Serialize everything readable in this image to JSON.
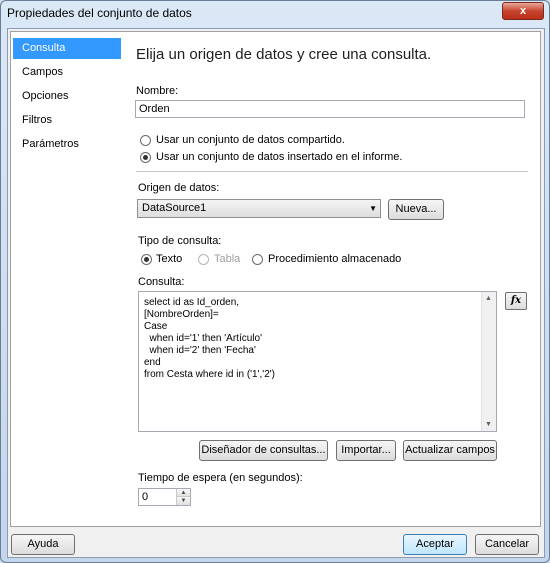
{
  "window": {
    "title": "Propiedades del conjunto de datos",
    "close_label": "x"
  },
  "sidebar": {
    "items": [
      {
        "label": "Consulta"
      },
      {
        "label": "Campos"
      },
      {
        "label": "Opciones"
      },
      {
        "label": "Filtros"
      },
      {
        "label": "Parámetros"
      }
    ],
    "selected": "Consulta"
  },
  "main": {
    "heading": "Elija un origen de datos y cree una consulta.",
    "name_label": "Nombre:",
    "name_value": "Orden",
    "radio_shared": "Usar un conjunto de datos compartido.",
    "radio_embedded": "Usar un conjunto de datos insertado en el informe.",
    "datasource_label": "Origen de datos:",
    "datasource_value": "DataSource1",
    "new_button": "Nueva...",
    "query_type_label": "Tipo de consulta:",
    "query_type_text": "Texto",
    "query_type_table": "Tabla",
    "query_type_sp": "Procedimiento almacenado",
    "query_label": "Consulta:",
    "query_lines": [
      "select id as Id_orden,",
      "[NombreOrden]=",
      "Case",
      "  when id='1' then 'Artículo'",
      "  when id='2' then 'Fecha'",
      "end",
      "from Cesta where id in ('1','2')"
    ],
    "fx_label": "fx",
    "designer_button": "Diseñador de consultas...",
    "import_button": "Importar...",
    "refresh_button": "Actualizar campos",
    "timeout_label": "Tiempo de espera (en segundos):",
    "timeout_value": "0"
  },
  "footer": {
    "help_button": "Ayuda",
    "ok_button": "Aceptar",
    "cancel_button": "Cancelar"
  }
}
